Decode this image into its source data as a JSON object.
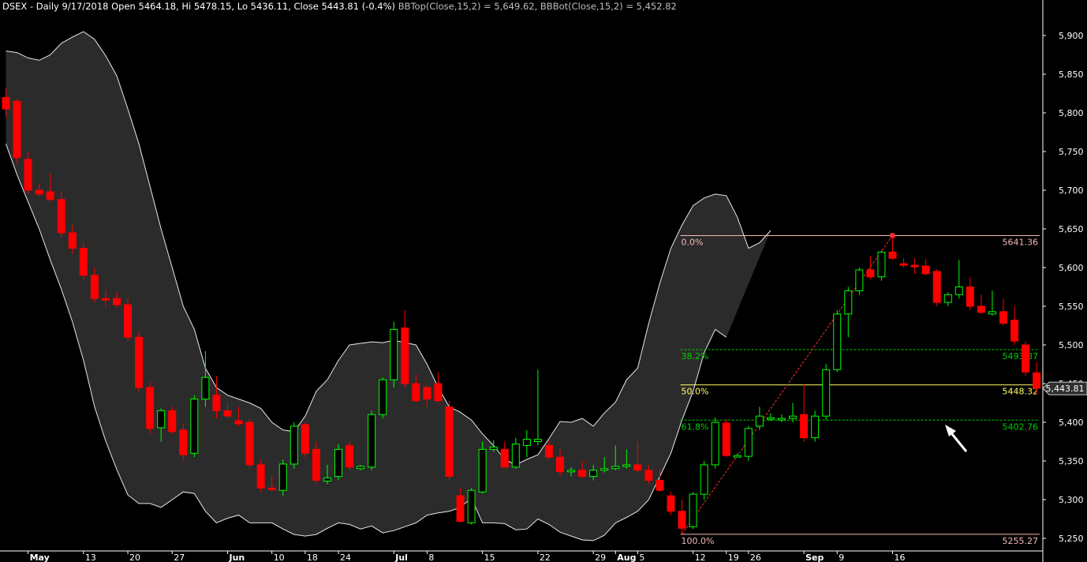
{
  "header": {
    "title": "DSEX - Daily 9/17/2018 Open 5464.18, Hi 5478.15, Lo 5436.11, Close 5443.81 (-0.4%)",
    "bbtop": "BBTop(Close,15,2) = 5,649.62,",
    "bbbot": "BBBot(Close,15,2) = 5,452.82"
  },
  "colors": {
    "background": "#000000",
    "band_fill": "#2b2b2b",
    "band_line": "#e8e8e8",
    "up": "#00ff00",
    "down": "#ff0000",
    "fib_line": "#f4b8b8",
    "fib_dashed": "#00cc00",
    "fib_50": "#ffff66",
    "price_tag_bg": "#2f2f2f"
  },
  "chart_data": {
    "type": "candlestick",
    "ylim": [
      5240,
      5930
    ],
    "y_ticks": [
      "5,250",
      "5,300",
      "5,350",
      "5,400",
      "5,450",
      "5,500",
      "5,550",
      "5,600",
      "5,650",
      "5,700",
      "5,750",
      "5,800",
      "5,850",
      "5,900"
    ],
    "x_labels": [
      {
        "label": "May",
        "bar": 2,
        "bold": true
      },
      {
        "label": "13",
        "bar": 7
      },
      {
        "label": "20",
        "bar": 11
      },
      {
        "label": "27",
        "bar": 15
      },
      {
        "label": "Jun",
        "bar": 20,
        "bold": true
      },
      {
        "label": "10",
        "bar": 24
      },
      {
        "label": "18",
        "bar": 27
      },
      {
        "label": "24",
        "bar": 30
      },
      {
        "label": "Jul",
        "bar": 35,
        "bold": true
      },
      {
        "label": "8",
        "bar": 38
      },
      {
        "label": "15",
        "bar": 43
      },
      {
        "label": "22",
        "bar": 48
      },
      {
        "label": "29",
        "bar": 53
      },
      {
        "label": "Aug",
        "bar": 55,
        "bold": true
      },
      {
        "label": "5",
        "bar": 57
      },
      {
        "label": "12",
        "bar": 62
      },
      {
        "label": "19",
        "bar": 65
      },
      {
        "label": "26",
        "bar": 67
      },
      {
        "label": "Sep",
        "bar": 72,
        "bold": true
      },
      {
        "label": "9",
        "bar": 75
      },
      {
        "label": "16",
        "bar": 80
      }
    ],
    "candles": [
      [
        5820,
        5832,
        5795,
        5805
      ],
      [
        5815,
        5818,
        5735,
        5742
      ],
      [
        5740,
        5750,
        5695,
        5700
      ],
      [
        5700,
        5708,
        5692,
        5695
      ],
      [
        5698,
        5722,
        5685,
        5688
      ],
      [
        5688,
        5698,
        5640,
        5645
      ],
      [
        5645,
        5655,
        5618,
        5625
      ],
      [
        5625,
        5632,
        5585,
        5590
      ],
      [
        5590,
        5600,
        5555,
        5560
      ],
      [
        5560,
        5570,
        5548,
        5558
      ],
      [
        5560,
        5568,
        5548,
        5552
      ],
      [
        5552,
        5560,
        5505,
        5510
      ],
      [
        5510,
        5518,
        5440,
        5445
      ],
      [
        5445,
        5452,
        5385,
        5392
      ],
      [
        5393,
        5418,
        5375,
        5415
      ],
      [
        5415,
        5420,
        5385,
        5388
      ],
      [
        5390,
        5398,
        5350,
        5358
      ],
      [
        5360,
        5435,
        5355,
        5430
      ],
      [
        5430,
        5492,
        5420,
        5458
      ],
      [
        5435,
        5460,
        5405,
        5415
      ],
      [
        5415,
        5425,
        5405,
        5408
      ],
      [
        5402,
        5420,
        5395,
        5398
      ],
      [
        5400,
        5405,
        5340,
        5345
      ],
      [
        5345,
        5352,
        5310,
        5315
      ],
      [
        5315,
        5330,
        5310,
        5313
      ],
      [
        5312,
        5352,
        5305,
        5346
      ],
      [
        5346,
        5400,
        5340,
        5395
      ],
      [
        5397,
        5400,
        5355,
        5360
      ],
      [
        5365,
        5375,
        5320,
        5325
      ],
      [
        5324,
        5345,
        5320,
        5328
      ],
      [
        5330,
        5372,
        5325,
        5365
      ],
      [
        5370,
        5375,
        5338,
        5342
      ],
      [
        5340,
        5345,
        5338,
        5343
      ],
      [
        5342,
        5415,
        5338,
        5410
      ],
      [
        5410,
        5458,
        5405,
        5455
      ],
      [
        5455,
        5530,
        5445,
        5520
      ],
      [
        5522,
        5545,
        5445,
        5450
      ],
      [
        5450,
        5462,
        5425,
        5428
      ],
      [
        5445,
        5448,
        5420,
        5430
      ],
      [
        5450,
        5465,
        5425,
        5428
      ],
      [
        5420,
        5428,
        5325,
        5330
      ],
      [
        5305,
        5315,
        5270,
        5272
      ],
      [
        5270,
        5315,
        5268,
        5312
      ],
      [
        5310,
        5375,
        5308,
        5365
      ],
      [
        5365,
        5377,
        5362,
        5368
      ],
      [
        5365,
        5375,
        5345,
        5342
      ],
      [
        5342,
        5380,
        5340,
        5372
      ],
      [
        5370,
        5390,
        5355,
        5378
      ],
      [
        5375,
        5468,
        5370,
        5378
      ],
      [
        5370,
        5378,
        5352,
        5355
      ],
      [
        5355,
        5365,
        5330,
        5336
      ],
      [
        5336,
        5342,
        5330,
        5338
      ],
      [
        5338,
        5350,
        5328,
        5330
      ],
      [
        5330,
        5345,
        5325,
        5338
      ],
      [
        5338,
        5355,
        5335,
        5340
      ],
      [
        5340,
        5370,
        5338,
        5343
      ],
      [
        5343,
        5365,
        5340,
        5345
      ],
      [
        5345,
        5375,
        5335,
        5338
      ],
      [
        5338,
        5345,
        5320,
        5325
      ],
      [
        5325,
        5340,
        5310,
        5312
      ],
      [
        5305,
        5310,
        5280,
        5285
      ],
      [
        5285,
        5300,
        5256,
        5263
      ],
      [
        5265,
        5310,
        5262,
        5307
      ],
      [
        5307,
        5350,
        5300,
        5345
      ],
      [
        5345,
        5406,
        5340,
        5400
      ],
      [
        5399,
        5404,
        5355,
        5357
      ],
      [
        5356,
        5360,
        5355,
        5357
      ],
      [
        5356,
        5395,
        5350,
        5392
      ],
      [
        5395,
        5420,
        5390,
        5408
      ],
      [
        5405,
        5412,
        5402,
        5406
      ],
      [
        5405,
        5410,
        5400,
        5405
      ],
      [
        5405,
        5425,
        5400,
        5408
      ],
      [
        5410,
        5450,
        5375,
        5380
      ],
      [
        5380,
        5415,
        5375,
        5408
      ],
      [
        5408,
        5475,
        5403,
        5468
      ],
      [
        5468,
        5545,
        5465,
        5540
      ],
      [
        5540,
        5575,
        5510,
        5570
      ],
      [
        5570,
        5600,
        5565,
        5597
      ],
      [
        5597,
        5615,
        5585,
        5588
      ],
      [
        5588,
        5622,
        5583,
        5620
      ],
      [
        5620,
        5640,
        5610,
        5612
      ],
      [
        5605,
        5612,
        5600,
        5603
      ],
      [
        5603,
        5612,
        5592,
        5601
      ],
      [
        5602,
        5611,
        5590,
        5592
      ],
      [
        5595,
        5598,
        5550,
        5555
      ],
      [
        5555,
        5568,
        5550,
        5565
      ],
      [
        5565,
        5610,
        5560,
        5575
      ],
      [
        5575,
        5588,
        5545,
        5550
      ],
      [
        5550,
        5565,
        5540,
        5542
      ],
      [
        5540,
        5570,
        5538,
        5543
      ],
      [
        5543,
        5560,
        5525,
        5528
      ],
      [
        5532,
        5550,
        5500,
        5505
      ],
      [
        5500,
        5505,
        5460,
        5465
      ],
      [
        5464,
        5478,
        5436,
        5444
      ]
    ],
    "bb_upper": [
      5880,
      5878,
      5871,
      5868,
      5875,
      5890,
      5898,
      5905,
      5895,
      5874,
      5848,
      5805,
      5760,
      5705,
      5650,
      5600,
      5550,
      5520,
      5470,
      5445,
      5435,
      5430,
      5425,
      5418,
      5400,
      5390,
      5388,
      5408,
      5440,
      5455,
      5480,
      5500,
      5502,
      5504,
      5503,
      5506,
      5503,
      5500,
      5475,
      5445,
      5420,
      5413,
      5403,
      5385,
      5370,
      5352,
      5345,
      5352,
      5358,
      5379,
      5401,
      5400,
      5405,
      5395,
      5412,
      5426,
      5455,
      5470,
      5528,
      5580,
      5625,
      5655,
      5680,
      5690,
      5695,
      5693,
      5665,
      5625,
      5632,
      5648
    ],
    "bb_lower": [
      5760,
      5720,
      5685,
      5650,
      5610,
      5572,
      5530,
      5480,
      5420,
      5376,
      5339,
      5306,
      5295,
      5295,
      5290,
      5300,
      5310,
      5308,
      5285,
      5270,
      5276,
      5280,
      5270,
      5270,
      5270,
      5262,
      5255,
      5253,
      5255,
      5263,
      5270,
      5268,
      5262,
      5266,
      5257,
      5260,
      5265,
      5270,
      5280,
      5283,
      5285,
      5290,
      5302,
      5270,
      5270,
      5269,
      5261,
      5262,
      5275,
      5268,
      5258,
      5253,
      5248,
      5247,
      5254,
      5270,
      5277,
      5285,
      5300,
      5330,
      5360,
      5403,
      5440,
      5490,
      5520,
      5510
    ],
    "bb_lower_start_bar": 28,
    "fib": {
      "high": 5641.36,
      "low": 5255.27,
      "start_bar": 61,
      "end_bar": 82,
      "levels": [
        {
          "pct": "0.0%",
          "value_label": "5641.36",
          "value": 5641.36,
          "style": "solid",
          "color": "#f4b8b8"
        },
        {
          "pct": "38.2%",
          "value_label": "5493.87",
          "value": 5493.87,
          "style": "dashed",
          "color": "#00cc00"
        },
        {
          "pct": "50.0%",
          "value_label": "5448.32",
          "value": 5448.32,
          "style": "solid",
          "color": "#ffff66"
        },
        {
          "pct": "61.8%",
          "value_label": "5402.76",
          "value": 5402.76,
          "style": "dashed",
          "color": "#00cc00"
        },
        {
          "pct": "100.0%",
          "value_label": "5255.27",
          "value": 5255.27,
          "style": "solid",
          "color": "#f4b8b8"
        }
      ]
    },
    "trend_line": {
      "from_bar": 61,
      "from_value": 5255.27,
      "to_bar": 80,
      "to_value": 5641.36
    },
    "last_price": {
      "value": 5443.81,
      "label": "5,443.81"
    }
  }
}
